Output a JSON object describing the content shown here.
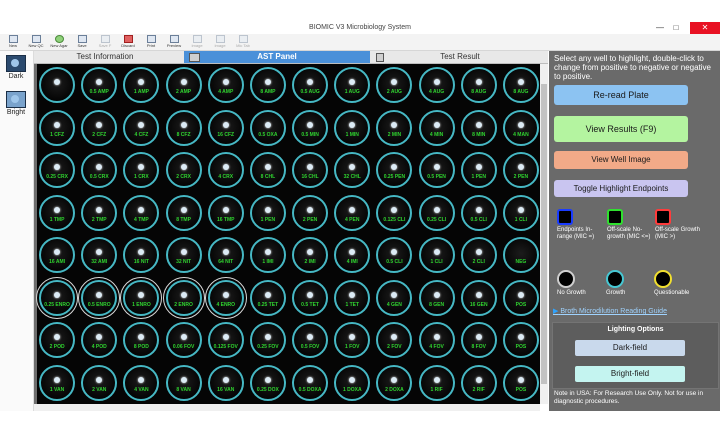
{
  "window": {
    "title": "BIOMIC V3 Microbiology System",
    "controls": [
      "—",
      "□",
      "✕"
    ]
  },
  "toolbar": [
    {
      "label": "New",
      "icon": "new-icon",
      "enabled": true
    },
    {
      "label": "New QC",
      "icon": "new-qc-icon",
      "enabled": true
    },
    {
      "label": "New Agar",
      "icon": "new-agar-icon",
      "enabled": true
    },
    {
      "label": "Save",
      "icon": "save-icon",
      "enabled": true
    },
    {
      "label": "Save F",
      "icon": "save-f-icon",
      "enabled": false
    },
    {
      "label": "Discard",
      "icon": "discard-icon",
      "enabled": true
    },
    {
      "label": "Print",
      "icon": "print-icon",
      "enabled": true
    },
    {
      "label": "Preview",
      "icon": "preview-icon",
      "enabled": true
    },
    {
      "label": "Image",
      "icon": "image-icon",
      "enabled": false
    },
    {
      "label": "Image",
      "icon": "image-icon",
      "enabled": false
    },
    {
      "label": "Mic Tab",
      "icon": "mic-tab-icon",
      "enabled": false
    }
  ],
  "left": {
    "dark_label": "Dark",
    "bright_label": "Bright"
  },
  "tabs": [
    {
      "label": "Test Information",
      "active": false
    },
    {
      "label": "AST Panel",
      "active": true
    },
    {
      "label": "Test Result",
      "active": false
    }
  ],
  "plate": {
    "rows": [
      [
        {
          "label": "",
          "empty": false
        },
        {
          "label": "0.5 AMP"
        },
        {
          "label": "1 AMP"
        },
        {
          "label": "2 AMP"
        },
        {
          "label": "4 AMP"
        },
        {
          "label": "8 AMP"
        },
        {
          "label": "0.5 AUG"
        },
        {
          "label": "1 AUG"
        },
        {
          "label": "2 AUG"
        },
        {
          "label": "4 AUG"
        },
        {
          "label": "8 AUG"
        },
        {
          "label": "8 AUG"
        }
      ],
      [
        {
          "label": "1 CFZ"
        },
        {
          "label": "2 CFZ"
        },
        {
          "label": "4 CFZ"
        },
        {
          "label": "8 CFZ"
        },
        {
          "label": "16 CFZ"
        },
        {
          "label": "0.5 OXA"
        },
        {
          "label": "0.5 MIN"
        },
        {
          "label": "1 MIN"
        },
        {
          "label": "2 MIN"
        },
        {
          "label": "4 MIN"
        },
        {
          "label": "8 MIN"
        },
        {
          "label": "4 MAN"
        }
      ],
      [
        {
          "label": "0.25 CRX"
        },
        {
          "label": "0.5 CRX"
        },
        {
          "label": "1 CRX"
        },
        {
          "label": "2 CRX"
        },
        {
          "label": "4 CRX"
        },
        {
          "label": "8 CHL"
        },
        {
          "label": "16 CHL"
        },
        {
          "label": "32 CHL"
        },
        {
          "label": "0.25 PEN"
        },
        {
          "label": "0.5 PEN"
        },
        {
          "label": "1 PEN"
        },
        {
          "label": "2 PEN"
        }
      ],
      [
        {
          "label": "1 TMP"
        },
        {
          "label": "2 TMP"
        },
        {
          "label": "4 TMP"
        },
        {
          "label": "8 TMP"
        },
        {
          "label": "16 TMP"
        },
        {
          "label": "1 PEN"
        },
        {
          "label": "2 PEN"
        },
        {
          "label": "4 PEN"
        },
        {
          "label": "0.125 CLI"
        },
        {
          "label": "0.25 CLI"
        },
        {
          "label": "0.5 CLI"
        },
        {
          "label": "1 CLI"
        }
      ],
      [
        {
          "label": "16 AMI"
        },
        {
          "label": "32 AMI"
        },
        {
          "label": "16 NIT"
        },
        {
          "label": "32 NIT"
        },
        {
          "label": "64 NIT"
        },
        {
          "label": "1 IMI"
        },
        {
          "label": "2 IMI"
        },
        {
          "label": "4 IMI"
        },
        {
          "label": "0.5 CLI"
        },
        {
          "label": "1 CLI"
        },
        {
          "label": "2 CLI"
        },
        {
          "label": "NEG",
          "empty": true
        }
      ],
      [
        {
          "label": "0.25 ENRO",
          "hl": true
        },
        {
          "label": "0.5 ENRO",
          "hl": true
        },
        {
          "label": "1 ENRO",
          "hl": true
        },
        {
          "label": "2 ENRO",
          "hl": true
        },
        {
          "label": "4 ENRO",
          "hl": true
        },
        {
          "label": "0.25 TET"
        },
        {
          "label": "0.5 TET"
        },
        {
          "label": "1 TET"
        },
        {
          "label": "4 GEN"
        },
        {
          "label": "8 GEN"
        },
        {
          "label": "16 GEN"
        },
        {
          "label": "POS"
        }
      ],
      [
        {
          "label": "2 POD"
        },
        {
          "label": "4 POD"
        },
        {
          "label": "8 POD"
        },
        {
          "label": "0.06 FOV"
        },
        {
          "label": "0.125 FOV"
        },
        {
          "label": "0.25 FOV"
        },
        {
          "label": "0.5 FOV"
        },
        {
          "label": "1 FOV"
        },
        {
          "label": "2 FOV"
        },
        {
          "label": "4 FOV"
        },
        {
          "label": "8 FOV"
        },
        {
          "label": "POS"
        }
      ],
      [
        {
          "label": "1 VAN"
        },
        {
          "label": "2 VAN"
        },
        {
          "label": "4 VAN"
        },
        {
          "label": "8 VAN"
        },
        {
          "label": "16 VAN"
        },
        {
          "label": "0.25 DOX"
        },
        {
          "label": "0.5 DOXA"
        },
        {
          "label": "1 DOXA"
        },
        {
          "label": "2 DOXA"
        },
        {
          "label": "1 RIF"
        },
        {
          "label": "2 RIF"
        },
        {
          "label": "POS"
        }
      ]
    ]
  },
  "panel": {
    "instructions": "Select any well to highlight, double-click to change from positive to negative or negative to positive.",
    "reread": "Re-read Plate",
    "view_results": "View Results (F9)",
    "view_well": "View Well Image",
    "toggle": "Toggle Highlight Endpoints",
    "legend_squares": [
      {
        "label": "Endpoints In-range (MIC =)",
        "color": "#1a3bff"
      },
      {
        "label": "Off-scale No-growth (MIC <=)",
        "color": "#2fe02f"
      },
      {
        "label": "Off-scale Growth (MIC >)",
        "color": "#ff3b3b"
      }
    ],
    "legend_circles": [
      {
        "label": "No Growth",
        "color": "#cfcfcf"
      },
      {
        "label": "Growth",
        "color": "#46c8d4"
      },
      {
        "label": "Questionable",
        "color": "#f2e02f"
      }
    ],
    "guide": "Broth Microdilution Reading Guide",
    "lighting_title": "Lighting Options",
    "dark_field": "Dark-field",
    "bright_field": "Bright-field",
    "note": "Note in USA: For Research Use Only. Not for use in diagnostic procedures."
  },
  "colors": {
    "accent": "#4a90d9",
    "well_ring": "#46b8c4",
    "well_label": "#2fd52f",
    "panel_bg": "#6a6a6a"
  }
}
